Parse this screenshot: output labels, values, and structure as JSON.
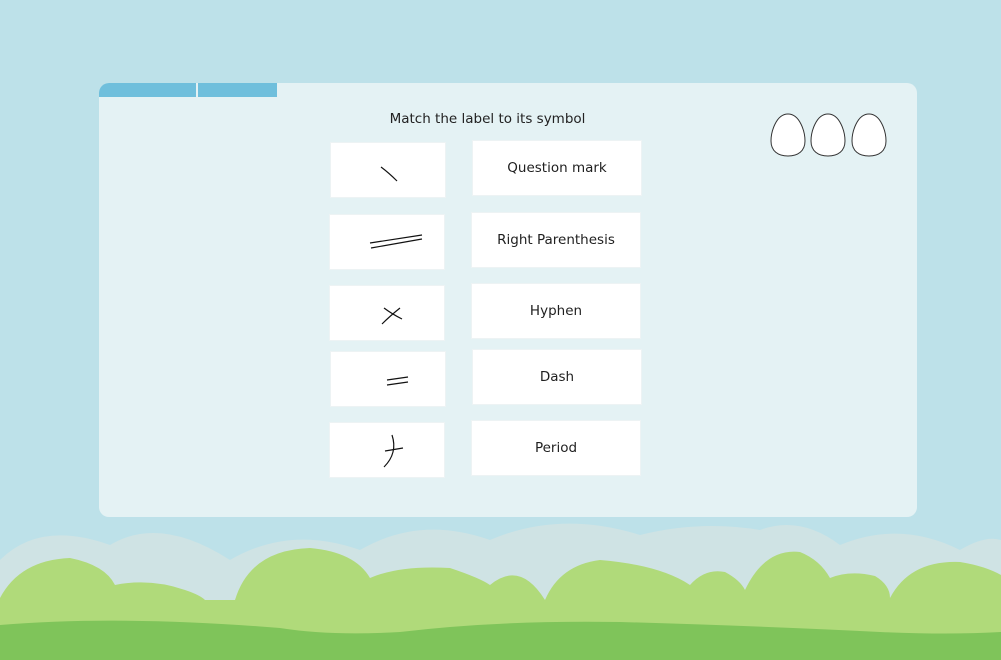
{
  "game": {
    "prompt": "Match the label to its symbol",
    "progress_segments_filled": 2,
    "lives": 3,
    "colors": {
      "sky": "#bde1e9",
      "panel": "#e4f2f4",
      "progress": "#6fbfdc",
      "bush_back": "#cfe3e4",
      "bush": "#b0da7a",
      "ground": "#7fc45a"
    }
  },
  "symbols": [
    {
      "name": "backslash-stroke-symbol"
    },
    {
      "name": "double-long-line-symbol"
    },
    {
      "name": "cross-stroke-symbol"
    },
    {
      "name": "short-equal-symbol"
    },
    {
      "name": "hook-cross-symbol"
    }
  ],
  "labels": [
    {
      "text": "Question mark"
    },
    {
      "text": "Right Parenthesis"
    },
    {
      "text": "Hyphen"
    },
    {
      "text": "Dash"
    },
    {
      "text": "Period"
    }
  ]
}
